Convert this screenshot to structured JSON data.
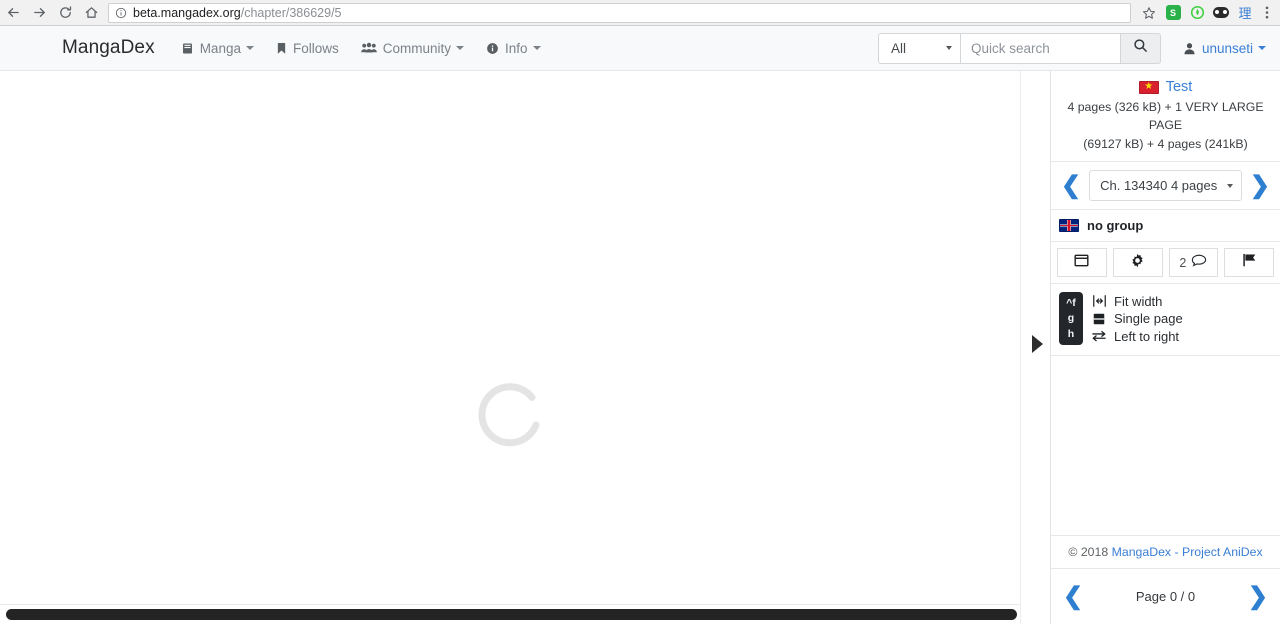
{
  "browser": {
    "back_icon": "arrow-left-icon",
    "forward_icon": "arrow-right-icon",
    "reload_icon": "reload-icon",
    "home_icon": "home-icon",
    "info_icon": "info-circle-icon",
    "url_host": "beta.mangadex.org",
    "url_path": "/chapter/386629/5",
    "bookmark_icon": "star-icon",
    "menu_icon": "kebab-menu-icon",
    "extensions": [
      {
        "name": "ext-s-icon",
        "label": "S",
        "color": "#2bb14a"
      },
      {
        "name": "ext-drop-icon",
        "label": "",
        "color": "#3ecf3e"
      },
      {
        "name": "ext-dark-icon",
        "label": "",
        "color": "#2b2b2b"
      },
      {
        "name": "ext-cjk-icon",
        "label": "理",
        "color": "#3a7fd5"
      }
    ]
  },
  "navbar": {
    "brand": "MangaDex",
    "items": [
      {
        "label": "Manga",
        "icon": "book-icon",
        "caret": true
      },
      {
        "label": "Follows",
        "icon": "bookmark-icon",
        "caret": false
      },
      {
        "label": "Community",
        "icon": "users-icon",
        "caret": true
      },
      {
        "label": "Info",
        "icon": "info-icon",
        "caret": true
      }
    ],
    "search_scope": "All",
    "search_placeholder": "Quick search",
    "search_value": "",
    "search_icon": "search-icon",
    "user_icon": "user-icon",
    "username": "ununseti"
  },
  "reader": {
    "spinner_label": "loading-spinner",
    "scrollbar_name": "horizontal-scrollbar",
    "collapse_handle": "sidebar-collapse-handle"
  },
  "sidebar": {
    "chapter": {
      "flag": "flag-vietnam",
      "title": "Test",
      "page_info_line1": "4 pages (326 kB) + 1 VERY LARGE PAGE",
      "page_info_line2": "(69127 kB) + 4 pages (241kB)"
    },
    "chapter_nav": {
      "prev_icon": "chevron-left-icon",
      "next_icon": "chevron-right-icon",
      "selected": "Ch. 134340 4 pages"
    },
    "group": {
      "flag": "flag-uk",
      "name": "no group"
    },
    "toolbar": [
      {
        "name": "window-mode-button",
        "icon": "window-icon",
        "label": ""
      },
      {
        "name": "settings-button",
        "icon": "gear-icon",
        "label": ""
      },
      {
        "name": "comments-button",
        "icon": "comment-icon",
        "label": "2"
      },
      {
        "name": "report-button",
        "icon": "flag-icon",
        "label": ""
      }
    ],
    "shortcuts": {
      "keys": [
        "^f",
        "g",
        "h"
      ],
      "rows": [
        {
          "icon": "fit-width-icon",
          "label": "Fit width"
        },
        {
          "icon": "single-page-icon",
          "label": "Single page"
        },
        {
          "icon": "left-to-right-icon",
          "label": "Left to right"
        }
      ]
    },
    "footer": {
      "copyright": "© 2018",
      "link": "MangaDex - Project AniDex"
    },
    "page_nav": {
      "prev_icon": "chevron-left-icon",
      "next_icon": "chevron-right-icon",
      "counter": "Page 0 / 0"
    }
  },
  "colors": {
    "accent": "#3a7fd5",
    "chevron": "#2f7fd0",
    "navbar_bg": "#f8f9fa"
  }
}
